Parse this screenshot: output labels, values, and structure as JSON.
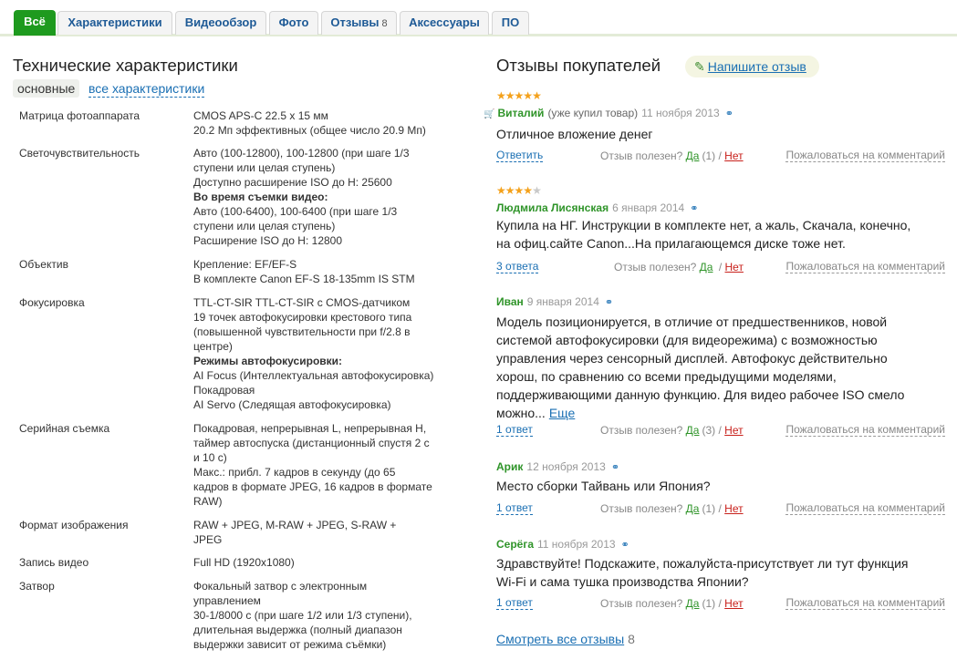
{
  "tabs": [
    {
      "label": "Всё",
      "active": true
    },
    {
      "label": "Характеристики"
    },
    {
      "label": "Видеообзор"
    },
    {
      "label": "Фото"
    },
    {
      "label": "Отзывы",
      "count": "8"
    },
    {
      "label": "Аксессуары"
    },
    {
      "label": "ПО"
    }
  ],
  "specs": {
    "title": "Технические характеристики",
    "subtab_active": "основные",
    "subtab_link": "все характеристики",
    "rows": [
      {
        "label": "Матрица фотоаппарата",
        "lines": [
          {
            "t": "CMOS APS-C 22.5 x 15 мм"
          },
          {
            "t": "20.2 Мп эффективных (общее число 20.9 Мп)"
          }
        ]
      },
      {
        "label": "Светочувствительность",
        "lines": [
          {
            "t": "Авто (100-12800), 100-12800 (при шаге 1/3"
          },
          {
            "t": "ступени или целая ступень)"
          },
          {
            "t": "Доступно расширение ISO до H: 25600"
          },
          {
            "t": "Во время съемки видео:",
            "b": true
          },
          {
            "t": "Авто (100-6400), 100-6400 (при шаге 1/3"
          },
          {
            "t": "ступени или целая ступень)"
          },
          {
            "t": "Расширение ISO до H: 12800"
          }
        ]
      },
      {
        "label": "Объектив",
        "lines": [
          {
            "t": "Крепление: EF/EF-S"
          },
          {
            "t": "В комплекте Canon EF-S 18-135mm IS STM"
          }
        ]
      },
      {
        "label": "Фокусировка",
        "lines": [
          {
            "t": "TTL-CT-SIR TTL-CT-SIR с CMOS-датчиком"
          },
          {
            "t": "19 точек автофокусировки крестового типа"
          },
          {
            "t": "(повышенной чувствительности при f/2.8 в"
          },
          {
            "t": "центре)"
          },
          {
            "t": "Режимы автофокусировки:",
            "b": true
          },
          {
            "t": "AI Focus (Интеллектуальная автофокусировка)"
          },
          {
            "t": "Покадровая"
          },
          {
            "t": "AI Servo (Следящая автофокусировка)"
          }
        ]
      },
      {
        "label": "Серийная съемка",
        "lines": [
          {
            "t": "Покадровая, непрерывная L, непрерывная H,"
          },
          {
            "t": "таймер автоспуска (дистанционный спустя 2 с"
          },
          {
            "t": "и 10 с)"
          },
          {
            "t": "Макс.: прибл. 7 кадров в секунду (до 65"
          },
          {
            "t": "кадров в формате JPEG, 16 кадров в формате"
          },
          {
            "t": "RAW)"
          }
        ]
      },
      {
        "label": "Формат изображения",
        "lines": [
          {
            "t": "RAW + JPEG, M-RAW + JPEG, S-RAW +"
          },
          {
            "t": "JPEG"
          }
        ]
      },
      {
        "label": "Запись видео",
        "lines": [
          {
            "t": "Full HD (1920x1080)"
          }
        ]
      },
      {
        "label": "Затвор",
        "lines": [
          {
            "t": "Фокальный затвор с электронным"
          },
          {
            "t": "управлением"
          },
          {
            "t": "30-1/8000 с (при шаге 1/2 или 1/3 ступени),"
          },
          {
            "t": "длительная выдержка (полный диапазон"
          },
          {
            "t": "выдержки зависит от режима съёмки)"
          }
        ]
      }
    ]
  },
  "reviews": {
    "title": "Отзывы покупателей",
    "write_label": "Напишите отзыв",
    "useful_label": "Отзыв полезен?",
    "yes_label": "Да",
    "no_label": "Нет",
    "complain_label": "Пожаловаться на комментарий",
    "items": [
      {
        "stars": 5,
        "author": "Виталий",
        "bought": "(уже купил товар)",
        "date": "11 ноября 2013",
        "text": [
          "Отличное вложение денег"
        ],
        "reply": "Ответить",
        "yes_count": "(1)",
        "no_count": ""
      },
      {
        "stars": 4,
        "author": "Людмила Лисянская",
        "date": "6 января 2014",
        "text": [
          "Купила на НГ. Инструкции в комплекте нет, а жаль, Скачала, конечно,",
          "на офиц.сайте Canon...На прилагающемся диске тоже нет."
        ],
        "reply": "3 ответа",
        "yes_count": "",
        "no_count": ""
      },
      {
        "author": "Иван",
        "date": "9 января 2014",
        "text": [
          "Модель позиционируется, в отличие от предшественников, новой",
          "системой автофокусировки (для видеорежима) с возможностью",
          "управления через сенсорный дисплей. Автофокус действительно",
          "хорош, по сравнению со всеми предыдущими моделями,",
          "поддерживающими данную функцию. Для видео рабочее ISO смело",
          "можно..."
        ],
        "more": "Еще",
        "reply": "1 ответ",
        "yes_count": "(3)",
        "no_count": ""
      },
      {
        "author": "Арик",
        "date": "12 ноября 2013",
        "text": [
          "Место сборки Тайвань или Япония?"
        ],
        "reply": "1 ответ",
        "yes_count": "(1)",
        "no_count": ""
      },
      {
        "author": "Серёга",
        "date": "11 ноября 2013",
        "text": [
          "Здравствуйте! Подскажите, пожалуйста-присутствует ли тут функция",
          "Wi-Fi и сама тушка производства Японии?"
        ],
        "reply": "1 ответ",
        "yes_count": "(1)",
        "no_count": ""
      }
    ],
    "all_label": "Смотреть все отзывы",
    "all_count": "8"
  },
  "colors": {
    "accent_green": "#1e9a1e",
    "link_blue": "#1a6fb3",
    "author_green": "#2f9429",
    "no_red": "#c8201b",
    "star": "#f4a11b"
  }
}
